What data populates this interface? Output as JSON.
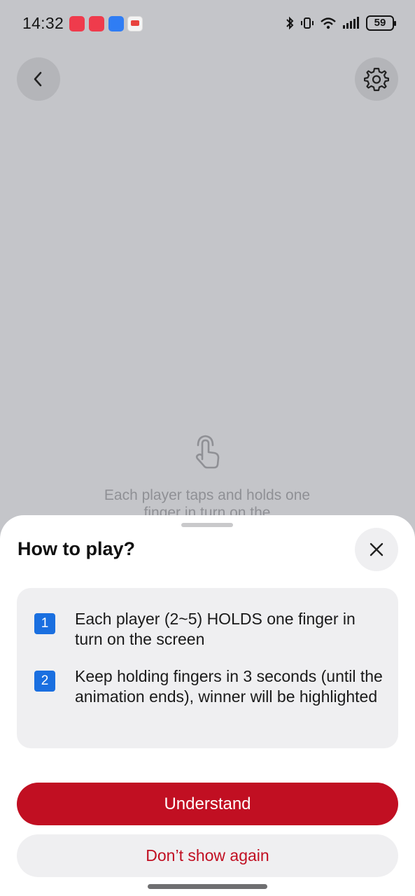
{
  "status_bar": {
    "time": "14:32",
    "battery": "59",
    "notification_icons": [
      "missed-call-icon",
      "app-gallery-icon",
      "blue-app-icon",
      "red-app-icon"
    ],
    "system_icons": [
      "bluetooth-icon",
      "vibrate-icon",
      "wifi-icon",
      "signal-icon",
      "battery-icon"
    ]
  },
  "header": {
    "back_icon": "chevron-left-icon",
    "settings_icon": "gear-icon"
  },
  "hint": {
    "icon": "tap-hold-icon",
    "text": "Each player taps and holds one finger in turn on the"
  },
  "sheet": {
    "title": "How to play?",
    "close_icon": "close-icon",
    "steps": [
      {
        "number": "1",
        "text": "Each player (2~5) HOLDS one finger in turn on the screen"
      },
      {
        "number": "2",
        "text": "Keep holding fingers in 3 seconds (until the animation ends), winner will be highlighted"
      }
    ],
    "primary_label": "Understand",
    "secondary_label": "Don’t show again"
  },
  "colors": {
    "background": "#c4c5c9",
    "accent": "#c10f22",
    "step_badge": "#1a6fe0",
    "sheet": "#ffffff"
  }
}
